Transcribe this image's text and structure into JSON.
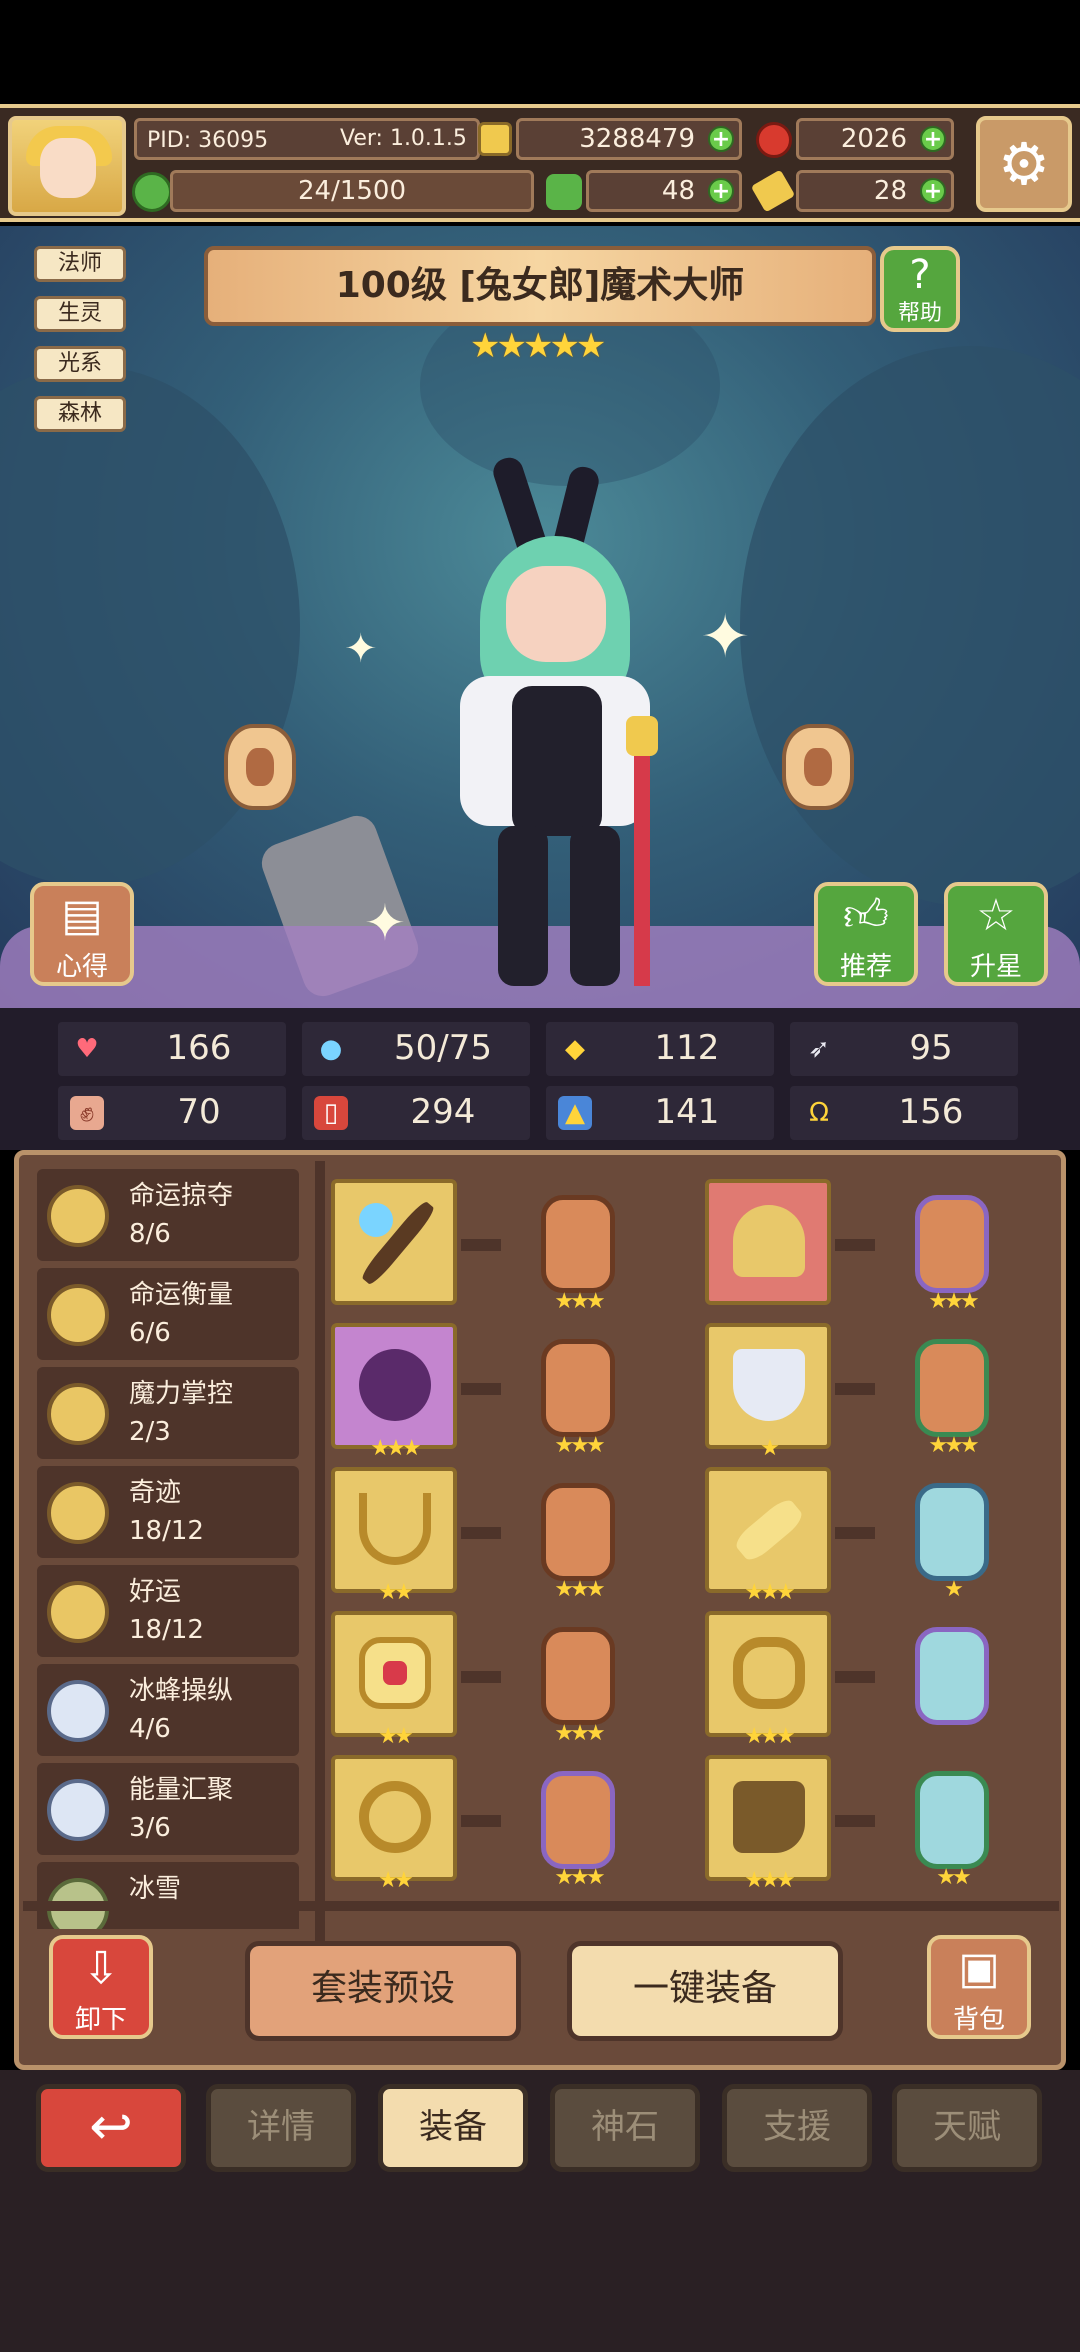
{
  "player": {
    "pid": "PID: 36095",
    "version": "Ver: 1.0.1.5",
    "gold": "3288479",
    "gems": "2026",
    "clover": "48",
    "key": "28",
    "stamina": "24/1500"
  },
  "hero": {
    "title": "100级 [兔女郎]魔术大师",
    "stars": "★★★★★",
    "tags": [
      "法师",
      "生灵",
      "光系",
      "森林"
    ],
    "help_label": "帮助",
    "notes_label": "心得",
    "recommend_label": "推荐",
    "star_up_label": "升星"
  },
  "stats": [
    {
      "icon": "heart-icon",
      "value": "166"
    },
    {
      "icon": "mana-drop-icon",
      "value": "50/75"
    },
    {
      "icon": "shield-icon",
      "value": "112"
    },
    {
      "icon": "wing-icon",
      "value": "95"
    },
    {
      "icon": "fist-icon",
      "value": "70"
    },
    {
      "icon": "book-icon",
      "value": "294"
    },
    {
      "icon": "boot-icon",
      "value": "141"
    },
    {
      "icon": "horseshoe-icon",
      "value": "156"
    }
  ],
  "skills": [
    {
      "name": "命运掠夺",
      "progress": "8/6"
    },
    {
      "name": "命运衡量",
      "progress": "6/6"
    },
    {
      "name": "魔力掌控",
      "progress": "2/3"
    },
    {
      "name": "奇迹",
      "progress": "18/12"
    },
    {
      "name": "好运",
      "progress": "18/12"
    },
    {
      "name": "冰蜂操纵",
      "progress": "4/6"
    },
    {
      "name": "能量汇聚",
      "progress": "3/6"
    },
    {
      "name": "冰雪",
      "progress": ""
    }
  ],
  "equipment": {
    "left": [
      {
        "item": "scepter",
        "item_stars": "",
        "rune_stars": "★★★"
      },
      {
        "item": "orb",
        "item_stars": "★★★",
        "rune_stars": "★★★"
      },
      {
        "item": "necklace",
        "item_stars": "★★",
        "rune_stars": "★★★"
      },
      {
        "item": "gem-brooch",
        "item_stars": "★★",
        "rune_stars": "★★★"
      },
      {
        "item": "ring",
        "item_stars": "★★",
        "rune_stars": "★★★"
      }
    ],
    "right": [
      {
        "item": "horn-crown",
        "item_stars": "",
        "rune_stars": "★★★"
      },
      {
        "item": "cape",
        "item_stars": "★",
        "rune_stars": "★★★"
      },
      {
        "item": "scroll",
        "item_stars": "★★★",
        "rune_stars": "★"
      },
      {
        "item": "bracelet",
        "item_stars": "★★★",
        "rune_stars": ""
      },
      {
        "item": "boots",
        "item_stars": "★★★",
        "rune_stars": "★★"
      }
    ]
  },
  "actions": {
    "unequip": "卸下",
    "preset": "套装预设",
    "equip_all": "一键装备",
    "bag": "背包"
  },
  "tabs": [
    "详情",
    "装备",
    "神石",
    "支援",
    "天赋"
  ],
  "colors": {
    "accent": "#e6c98c",
    "panel": "#6a4a3a",
    "active_tab": "#f3dcae"
  }
}
